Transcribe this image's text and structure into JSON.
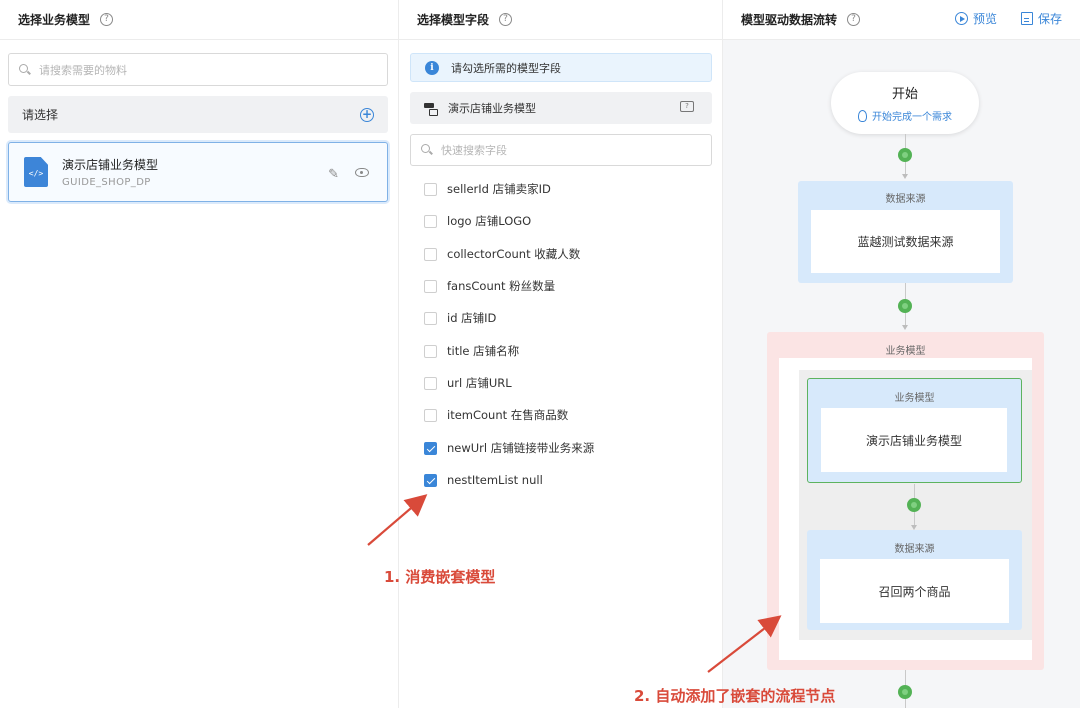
{
  "panel_left": {
    "title": "选择业务模型",
    "help": "?",
    "search_placeholder": "请搜索需要的物料",
    "select_label": "请选择",
    "add": "+",
    "model": {
      "name": "演示店铺业务模型",
      "code": "GUIDE_SHOP_DP",
      "icon_text": "</>"
    }
  },
  "panel_middle": {
    "title": "选择模型字段",
    "help": "?",
    "info_icon": "i",
    "info_text": "请勾选所需的模型字段",
    "model_name": "演示店铺业务模型",
    "search_placeholder": "快速搜索字段",
    "fields": [
      {
        "label": "sellerId 店铺卖家ID",
        "checked": false
      },
      {
        "label": "logo 店铺LOGO",
        "checked": false
      },
      {
        "label": "collectorCount 收藏人数",
        "checked": false
      },
      {
        "label": "fansCount 粉丝数量",
        "checked": false
      },
      {
        "label": "id 店铺ID",
        "checked": false
      },
      {
        "label": "title 店铺名称",
        "checked": false
      },
      {
        "label": "url 店铺URL",
        "checked": false
      },
      {
        "label": "itemCount 在售商品数",
        "checked": false
      },
      {
        "label": "newUrl 店铺链接带业务来源",
        "checked": true
      },
      {
        "label": "nestItemList null",
        "checked": true
      }
    ]
  },
  "panel_right": {
    "title": "模型驱动数据流转",
    "help": "?",
    "preview_label": "预览",
    "save_label": "保存",
    "start_node": {
      "title": "开始",
      "subtitle": "开始完成一个需求"
    },
    "source_node": {
      "caption": "数据来源",
      "name": "蓝越测试数据来源"
    },
    "biz_group": {
      "caption": "业务模型",
      "model_node": {
        "caption": "业务模型",
        "name": "演示店铺业务模型"
      },
      "source_node": {
        "caption": "数据来源",
        "name": "召回两个商品"
      }
    }
  },
  "annotations": {
    "first": "1. 消费嵌套模型",
    "second": "2. 自动添加了嵌套的流程节点"
  },
  "colors": {
    "accent": "#3a86d8",
    "annotation": "#d94a3a",
    "connector_dot": "#53b255"
  }
}
